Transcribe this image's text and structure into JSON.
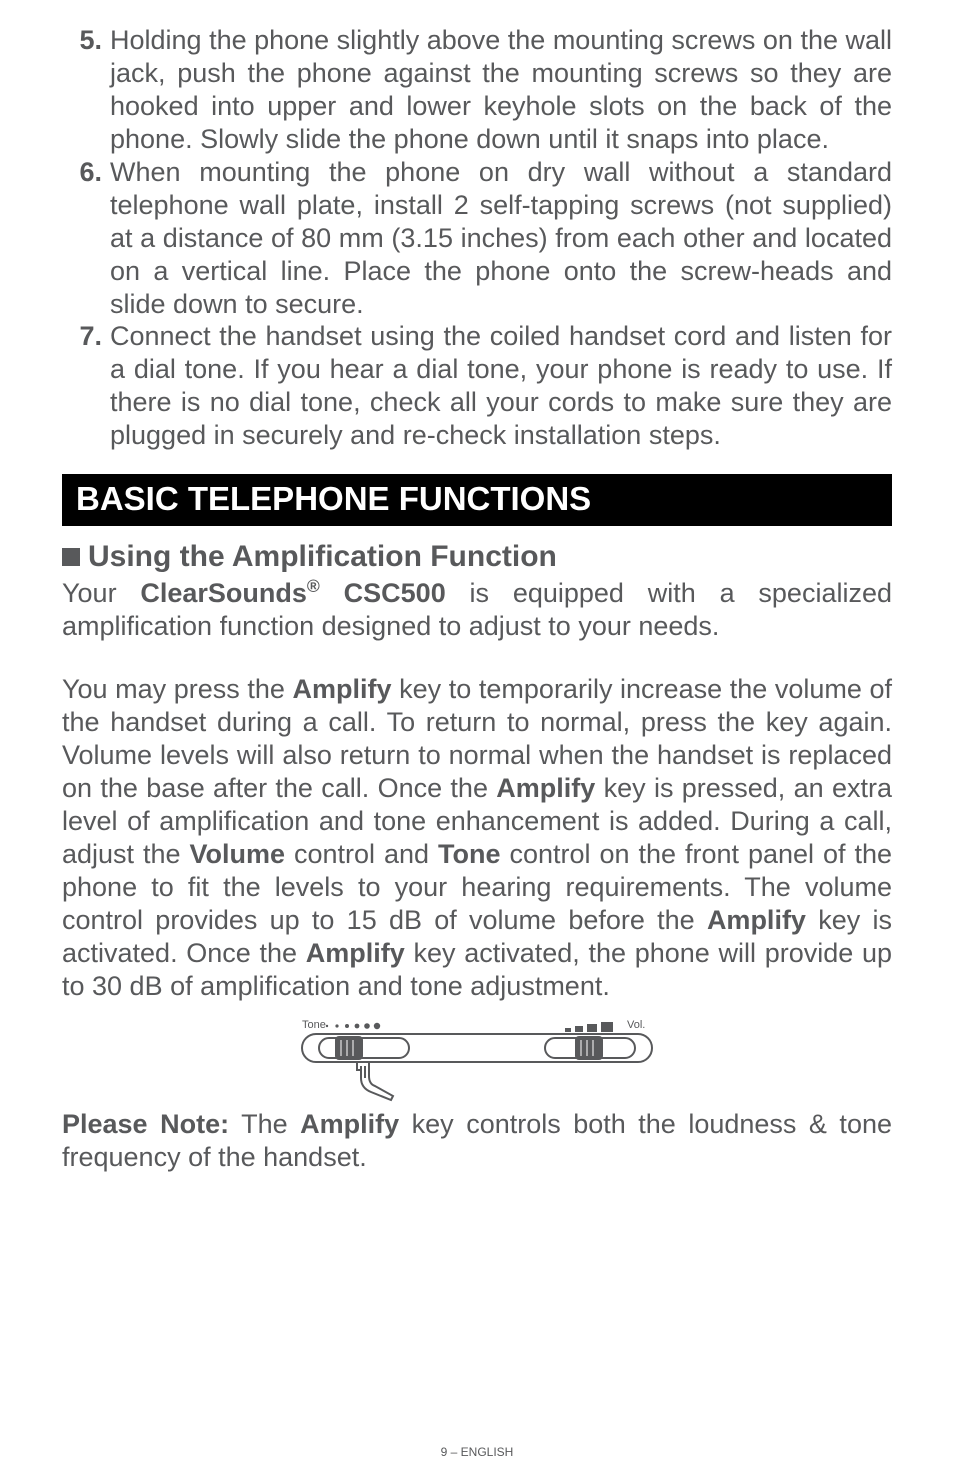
{
  "steps": [
    {
      "num": "5.",
      "text": "Holding the phone slightly above the mounting screws on the wall jack, push the phone against the mounting screws so they are hooked into upper and lower keyhole slots on the back of the phone. Slowly slide the phone down until it snaps into place."
    },
    {
      "num": "6.",
      "text": "When mounting the phone on dry wall without a standard telephone wall plate, install 2 self-tapping screws (not supplied) at a distance of 80 mm (3.15 inches) from each other and located on a vertical line. Place the phone onto the screw-heads and slide down to secure."
    },
    {
      "num": "7.",
      "text": "Connect the handset using the coiled handset cord and listen for a dial tone. If you hear a dial tone, your phone is ready to use. If there is no dial tone, check all your cords to make sure they are plugged in securely and re-check installation steps."
    }
  ],
  "section_title": "BASIC TELEPHONE FUNCTIONS",
  "subsection_title": "Using the Amplification Function",
  "para1": {
    "pre": "Your ",
    "brand": "ClearSounds",
    "reg": "®",
    "model": " CSC500",
    "post": " is equipped with a specialized amplification function designed to adjust to your needs."
  },
  "para2": {
    "s1a": "You may press the ",
    "amplify": "Amplify",
    "s1b": " key to temporarily increase the volume of the handset during a call. To return to normal, press the key again. Volume levels will also return to normal when the handset is replaced on the base after the call. Once the ",
    "s1c": " key is pressed, an extra level of amplification and tone enhancement is added. During a call, adjust the ",
    "volume": "Volume",
    "s1d": " control and ",
    "tone": "Tone",
    "s1e": " control on the front panel of the phone to fit the levels to your hearing requirements.  The volume control provides up to 15 dB of volume before the ",
    "s1f": " key is activated. Once the ",
    "s1g": " key activated, the phone will provide up to 30 dB of amplification and tone adjustment."
  },
  "figure": {
    "tone_label": "Tone",
    "vol_label": "Vol."
  },
  "para3": {
    "pn": "Please Note:",
    "a": " The ",
    "amplify": "Amplify",
    "b": " key controls both the loudness & tone frequency of the handset."
  },
  "footer": "9 – ENGLISH"
}
